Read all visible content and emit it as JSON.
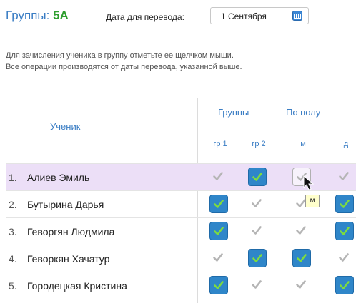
{
  "header": {
    "title_prefix": "Группы: ",
    "group_name": "5А",
    "date_label": "Дата для перевода:",
    "date_value": "1 Сентября"
  },
  "info": {
    "line1": "Для зачисления ученика в группу отметьте ее щелчком мыши.",
    "line2": "Все операции производятся от даты перевода, указанной выше."
  },
  "table": {
    "student_header": "Ученик",
    "groups_header": "Группы",
    "gender_header": "По полу",
    "sub_headers": [
      "гр 1",
      "гр 2",
      "м",
      "д"
    ],
    "rows": [
      {
        "num": "1.",
        "name": "Алиев Эмиль",
        "cells": [
          false,
          true,
          false,
          false
        ]
      },
      {
        "num": "2.",
        "name": "Бутырина Дарья",
        "cells": [
          true,
          false,
          false,
          true
        ]
      },
      {
        "num": "3.",
        "name": "Геворгян Людмила",
        "cells": [
          true,
          false,
          false,
          true
        ]
      },
      {
        "num": "4.",
        "name": "Геворкян Хачатур",
        "cells": [
          false,
          true,
          true,
          false
        ]
      },
      {
        "num": "5.",
        "name": "Городецкая Кристина",
        "cells": [
          true,
          false,
          false,
          true
        ]
      }
    ]
  },
  "tooltip": "м",
  "colors": {
    "accent": "#3a7dc4",
    "group": "#2f9e2f",
    "checked_bg": "#2f86c9",
    "check_on": "#7ddc3f",
    "check_off": "#b5b5b5",
    "highlight_row": "#ecdff7"
  }
}
